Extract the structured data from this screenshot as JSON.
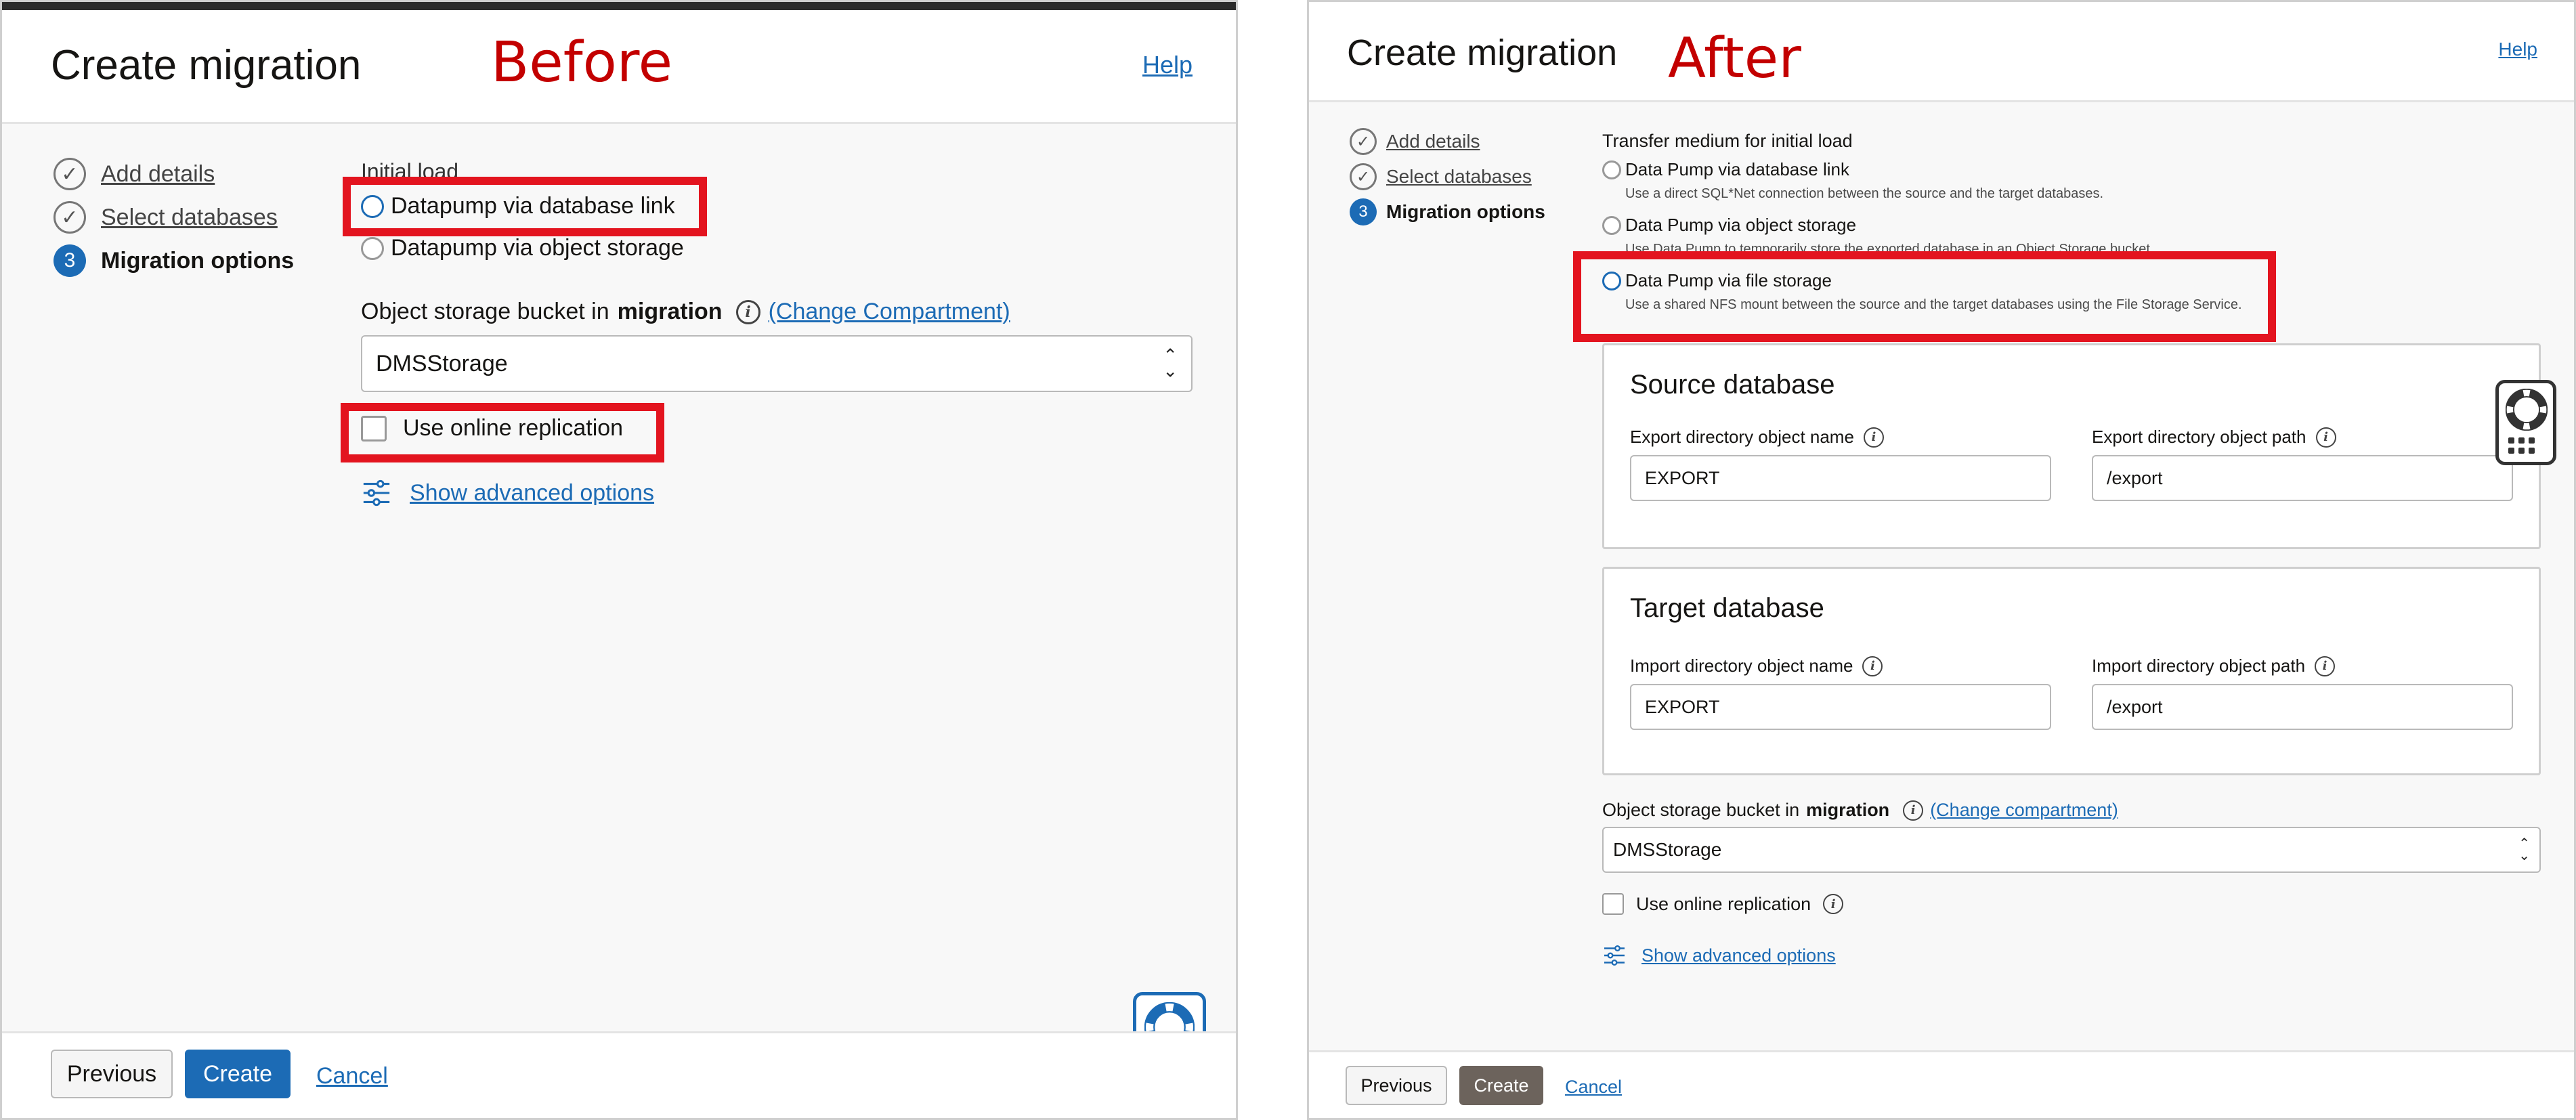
{
  "before": {
    "title": "Create migration",
    "annotation": "Before",
    "help": "Help",
    "steps": [
      {
        "icon": "check-circle-icon",
        "label": "Add details"
      },
      {
        "icon": "check-circle-icon",
        "label": "Select databases"
      },
      {
        "number": "3",
        "label": "Migration options"
      }
    ],
    "initial_load_label": "Initial load",
    "radios": [
      {
        "label": "Datapump via database link",
        "selected": true
      },
      {
        "label": "Datapump via object storage",
        "selected": false
      }
    ],
    "bucket": {
      "label_prefix": "Object storage bucket in",
      "compartment": "migration",
      "change_link": "(Change Compartment)",
      "value": "DMSStorage"
    },
    "online_replication": {
      "label": "Use online replication",
      "checked": false
    },
    "advanced_link": "Show advanced options",
    "footer": {
      "previous": "Previous",
      "create": "Create",
      "cancel": "Cancel"
    }
  },
  "after": {
    "title": "Create migration",
    "annotation": "After",
    "help": "Help",
    "steps": [
      {
        "icon": "check-circle-icon",
        "label": "Add details"
      },
      {
        "icon": "check-circle-icon",
        "label": "Select databases"
      },
      {
        "number": "3",
        "label": "Migration options"
      }
    ],
    "transfer_label": "Transfer medium for initial load",
    "radios": [
      {
        "label": "Data Pump via database link",
        "hint": "Use a direct SQL*Net connection between the source and the target databases.",
        "selected": false
      },
      {
        "label": "Data Pump via object storage",
        "hint": "Use Data Pump to temporarily store the exported database in an Object Storage bucket.",
        "selected": false
      },
      {
        "label": "Data Pump via file storage",
        "hint": "Use a shared NFS mount between the source and the target databases using the File Storage Service.",
        "selected": true
      }
    ],
    "source": {
      "title": "Source database",
      "name_label": "Export directory object name",
      "name_value": "EXPORT",
      "path_label": "Export directory object path",
      "path_value": "/export"
    },
    "target": {
      "title": "Target database",
      "name_label": "Import directory object name",
      "name_value": "EXPORT",
      "path_label": "Import directory object path",
      "path_value": "/export"
    },
    "bucket": {
      "label_prefix": "Object storage bucket in",
      "compartment": "migration",
      "change_link": "(Change compartment)",
      "value": "DMSStorage"
    },
    "online_replication": {
      "label": "Use online replication",
      "checked": false
    },
    "advanced_link": "Show advanced options",
    "footer": {
      "previous": "Previous",
      "create": "Create",
      "cancel": "Cancel"
    }
  },
  "colors": {
    "accent": "#1c6bb5",
    "annotation_red": "#c30000",
    "highlight_red": "#e3141f",
    "create_dark": "#6c635c"
  }
}
